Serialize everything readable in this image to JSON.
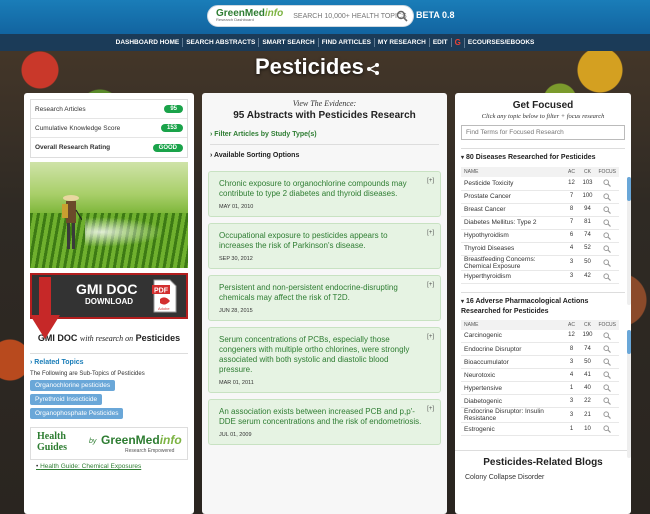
{
  "header": {
    "logo_main": "GreenMed",
    "logo_accent": "info",
    "logo_sub": "Research Dashboard",
    "search_placeholder": "SEARCH 10,000+ HEALTH TOPICS",
    "beta": "BETA 0.8"
  },
  "nav": [
    "DASHBOARD HOME",
    "SEARCH ABSTRACTS",
    "SMART SEARCH",
    "FIND ARTICLES",
    "MY RESEARCH",
    "EDIT",
    "ECOURSES/EBOOKS"
  ],
  "nav_google": "G",
  "title": "Pesticides",
  "stats": [
    {
      "label": "Research Articles",
      "value": "95"
    },
    {
      "label": "Cumulative Knowledge Score",
      "value": "153"
    },
    {
      "label": "Overall Research Rating",
      "value": "GOOD"
    }
  ],
  "gmi_doc": {
    "title": "GMI DOC",
    "sub": "DOWNLOAD",
    "pdf": "PDF",
    "pdf_sub": "Adobe",
    "caption_pre": "GMI DOC",
    "caption_mid": "with research on",
    "caption_topic": "Pesticides"
  },
  "related": {
    "heading": "Related Topics",
    "note": "The Following are Sub-Topics of Pesticides",
    "tags": [
      "Organochlorine pesticides",
      "Pyrethroid Insecticide",
      "Organophosphate Pesticides"
    ]
  },
  "health_guides": {
    "left_1": "Health",
    "left_2": "Guides",
    "by": "by",
    "logo_main": "GreenMed",
    "logo_accent": "info",
    "sub": "Research Empowered",
    "link": "Health Guide: Chemical Exposures"
  },
  "middle": {
    "view": "View The Evidence:",
    "heading": "95 Abstracts with Pesticides Research",
    "filter": "Filter Articles by Study Type(s)",
    "sort": "Available Sorting Options",
    "cards": [
      {
        "title": "Chronic exposure to organochlorine compounds may contribute to type 2 diabetes and thyroid diseases.",
        "date": "MAY 01, 2010"
      },
      {
        "title": "Occupational exposure to pesticides appears to increases the risk of Parkinson's disease.",
        "date": "SEP 30, 2012"
      },
      {
        "title": "Persistent and non-persistent endocrine-disrupting chemicals may affect the risk of T2D.",
        "date": "JUN 28, 2015"
      },
      {
        "title": "Serum concentrations of PCBs, especially those congeners with multiple ortho chlorines, were strongly associated with both systolic and diastolic blood pressure.",
        "date": "MAR 01, 2011"
      },
      {
        "title": "An association exists between increased PCB and p,p'-DDE serum concentrations and the risk of endometriosis.",
        "date": "JUL 01, 2009"
      }
    ],
    "plus": "[+]"
  },
  "right": {
    "title": "Get Focused",
    "sub": "Click any topic below to filter + focus research",
    "input_placeholder": "Find Terms for Focused Research",
    "diseases_heading": "80 Diseases Researched for Pesticides",
    "pharm_heading": "16 Adverse Pharmacological Actions Researched for Pesticides",
    "columns": [
      "NAME",
      "AC",
      "CK",
      "FOCUS"
    ],
    "diseases": [
      {
        "name": "Pesticide Toxicity",
        "ac": "12",
        "ck": "103"
      },
      {
        "name": "Prostate Cancer",
        "ac": "7",
        "ck": "100"
      },
      {
        "name": "Breast Cancer",
        "ac": "8",
        "ck": "94"
      },
      {
        "name": "Diabetes Mellitus: Type 2",
        "ac": "7",
        "ck": "81"
      },
      {
        "name": "Hypothyroidism",
        "ac": "6",
        "ck": "74"
      },
      {
        "name": "Thyroid Diseases",
        "ac": "4",
        "ck": "52"
      },
      {
        "name": "Breastfeeding Concerns: Chemical Exposure",
        "ac": "3",
        "ck": "50"
      },
      {
        "name": "Hyperthyroidism",
        "ac": "3",
        "ck": "42"
      }
    ],
    "pharm": [
      {
        "name": "Carcinogenic",
        "ac": "12",
        "ck": "190"
      },
      {
        "name": "Endocrine Disruptor",
        "ac": "8",
        "ck": "74"
      },
      {
        "name": "Bioaccumulator",
        "ac": "3",
        "ck": "50"
      },
      {
        "name": "Neurotoxic",
        "ac": "4",
        "ck": "41"
      },
      {
        "name": "Hypertensive",
        "ac": "1",
        "ck": "40"
      },
      {
        "name": "Diabetogenic",
        "ac": "3",
        "ck": "22"
      },
      {
        "name": "Endocrine Disruptor: Insulin Resistance",
        "ac": "3",
        "ck": "21"
      },
      {
        "name": "Estrogenic",
        "ac": "1",
        "ck": "10"
      }
    ],
    "blogs_heading": "Pesticides-Related Blogs",
    "blog_first": "Colony Collapse Disorder"
  },
  "colors": {
    "topbar": "#1a7db8",
    "navbar": "#1b3b58",
    "green": "#2e7d32",
    "badge": "#1aa34a",
    "card_bg": "#e6f3e3"
  }
}
